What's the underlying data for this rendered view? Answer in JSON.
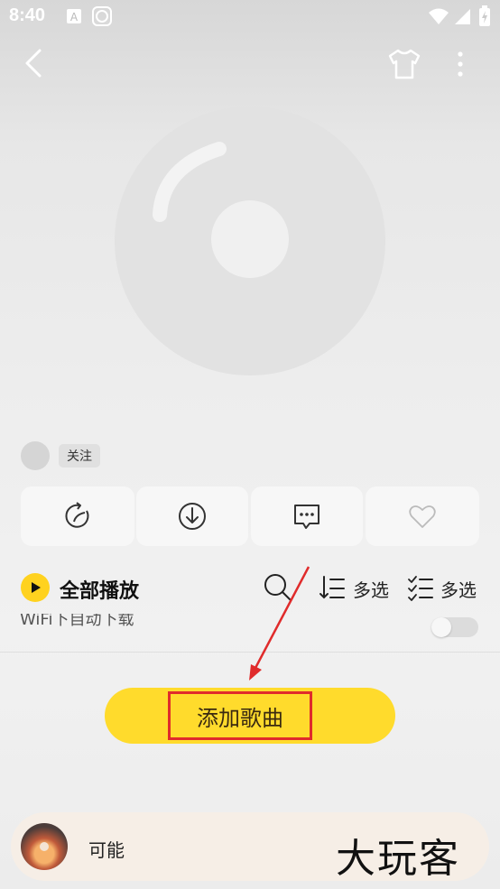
{
  "status_bar": {
    "time": "8:40"
  },
  "author": {
    "follow_label": "关注"
  },
  "toolbar": {
    "play_all_label": "全部播放",
    "multi_select_label_1": "多选",
    "multi_select_label_2": "多选"
  },
  "wifi_row": {
    "label": "WiFi下自动下载"
  },
  "main": {
    "add_song_label": "添加歌曲"
  },
  "mini_player": {
    "song_title": "可能"
  },
  "watermark": {
    "text": "大玩客"
  },
  "colors": {
    "accent": "#ffd21f",
    "highlight_border": "#e02b2b"
  }
}
